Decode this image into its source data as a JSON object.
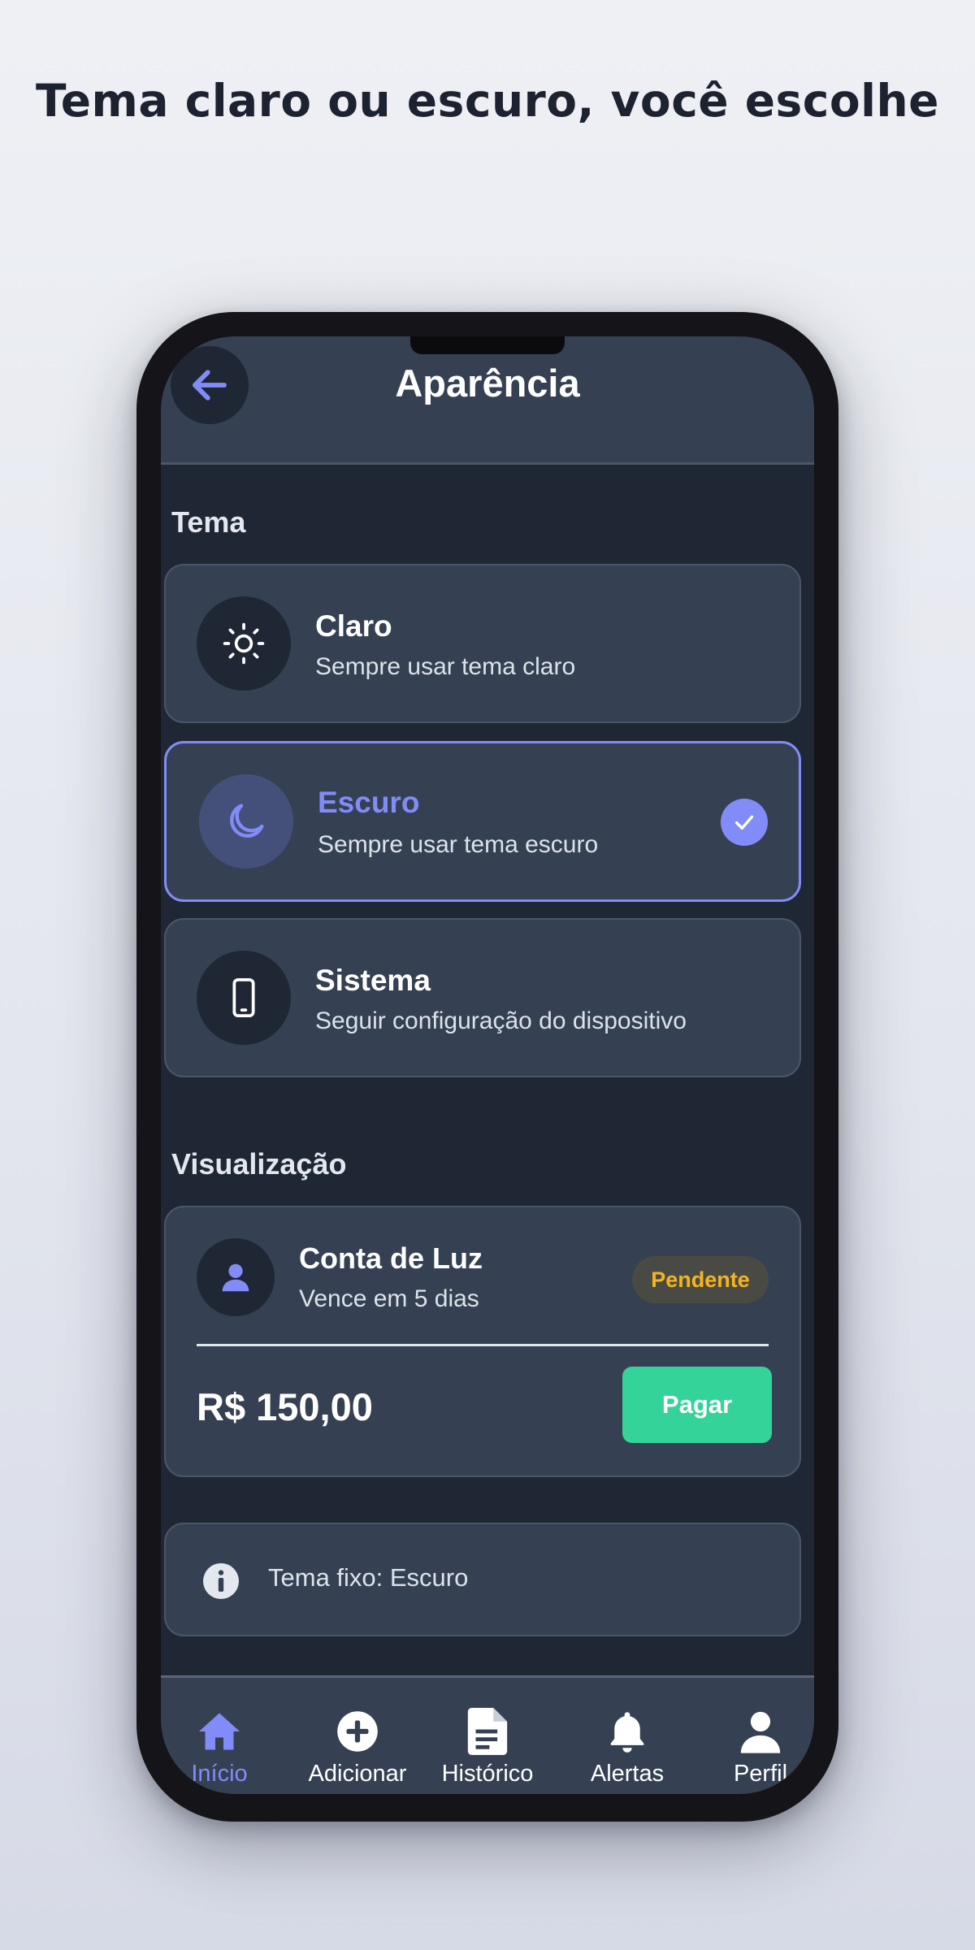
{
  "headline": "Tema claro ou escuro, você escolhe",
  "header": {
    "title": "Aparência",
    "back_icon": "arrow-left-icon"
  },
  "theme_section": {
    "label": "Tema",
    "options": [
      {
        "title": "Claro",
        "subtitle": "Sempre usar tema claro",
        "icon": "sun-icon",
        "selected": false
      },
      {
        "title": "Escuro",
        "subtitle": "Sempre usar tema escuro",
        "icon": "moon-icon",
        "selected": true
      },
      {
        "title": "Sistema",
        "subtitle": "Seguir configuração do dispositivo",
        "icon": "smartphone-icon",
        "selected": false
      }
    ]
  },
  "preview_section": {
    "label": "Visualização",
    "bill": {
      "title": "Conta de Luz",
      "subtitle": "Vence em 5 dias",
      "status": "Pendente",
      "amount": "R$ 150,00",
      "pay_label": "Pagar"
    }
  },
  "info": {
    "text": "Tema fixo: Escuro",
    "icon": "info-icon"
  },
  "tabbar": {
    "items": [
      {
        "label": "Início",
        "icon": "home-icon",
        "active": true
      },
      {
        "label": "Adicionar",
        "icon": "plus-circle-icon",
        "active": false
      },
      {
        "label": "Histórico",
        "icon": "document-icon",
        "active": false
      },
      {
        "label": "Alertas",
        "icon": "bell-icon",
        "active": false
      },
      {
        "label": "Perfil",
        "icon": "user-icon",
        "active": false
      }
    ]
  },
  "colors": {
    "accent": "#818cf8",
    "success": "#34d399",
    "warning": "#f3b51f",
    "surface": "#354152",
    "background": "#1f2734"
  }
}
